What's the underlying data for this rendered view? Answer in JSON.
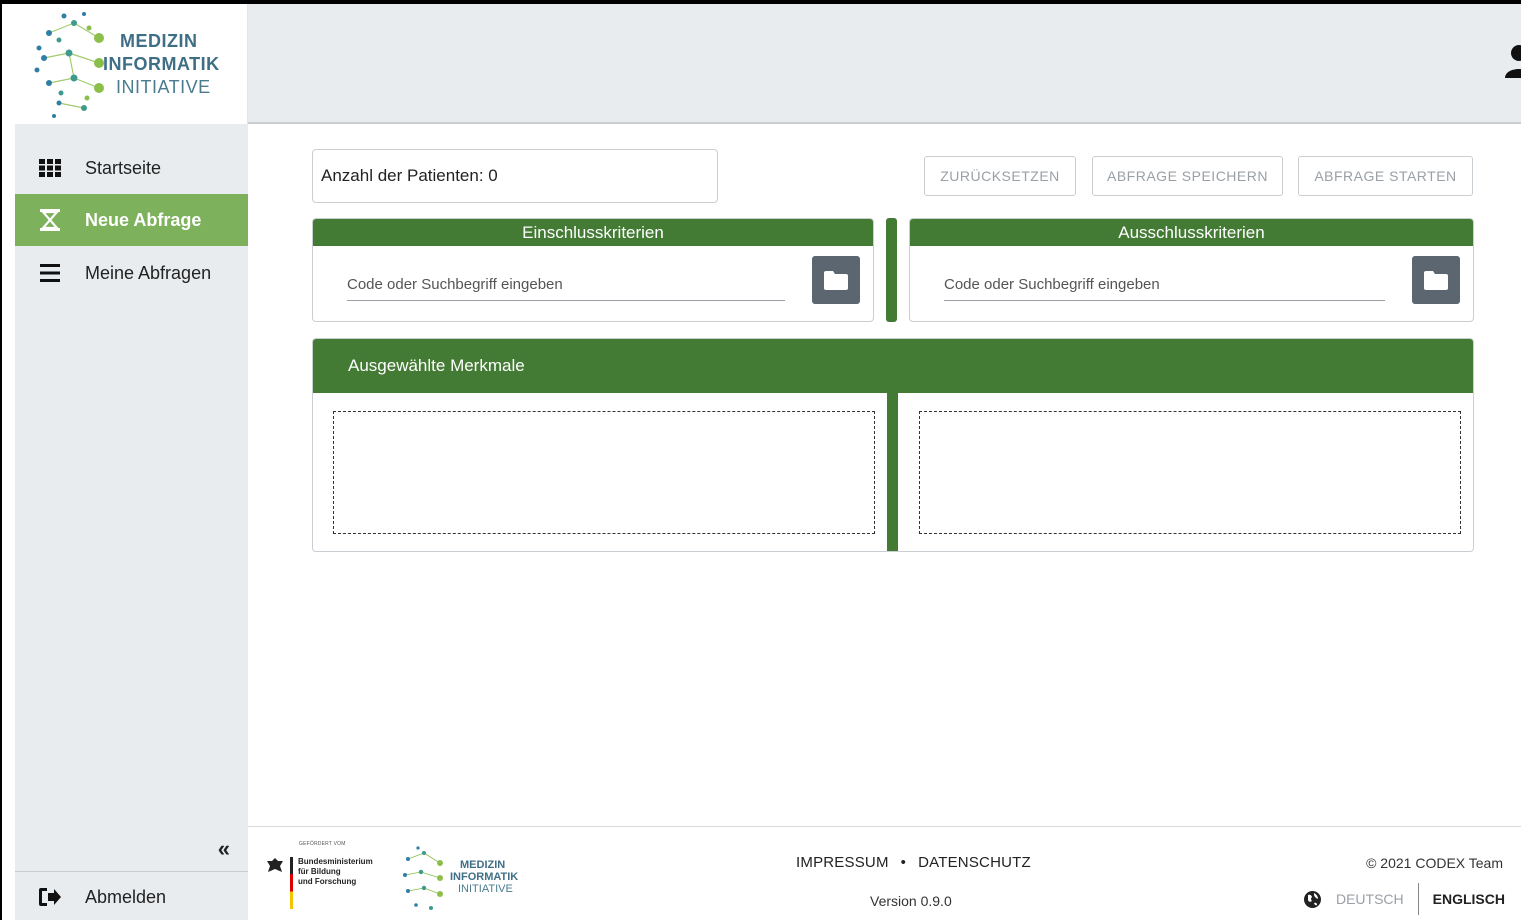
{
  "logo": {
    "line1": "MEDIZIN",
    "line2": "INFORMATIK",
    "line3": "INITIATIVE"
  },
  "sidebar": {
    "items": [
      {
        "label": "Startseite",
        "icon": "grid-icon"
      },
      {
        "label": "Neue Abfrage",
        "icon": "hourglass-icon",
        "active": true
      },
      {
        "label": "Meine Abfragen",
        "icon": "menu-icon"
      }
    ],
    "collapse": "«",
    "logout": "Abmelden"
  },
  "main": {
    "patients": "Anzahl der Patienten: 0",
    "buttons": {
      "reset": "ZURÜCKSETZEN",
      "save": "ABFRAGE SPEICHERN",
      "start": "ABFRAGE STARTEN"
    },
    "inclusion": {
      "title": "Einschlusskriterien",
      "placeholder": "Code oder Suchbegriff eingeben"
    },
    "exclusion": {
      "title": "Ausschlusskriterien",
      "placeholder": "Code oder Suchbegriff eingeben"
    },
    "selected_title": "Ausgewählte Merkmale"
  },
  "footer": {
    "funded_by": "GEFÖRDERT VOM",
    "bmbf_line1": "Bundesministerium",
    "bmbf_line2": "für Bildung",
    "bmbf_line3": "und Forschung",
    "logo_line1": "MEDIZIN",
    "logo_line2": "INFORMATIK",
    "logo_line3": "INITIATIVE",
    "impressum": "IMPRESSUM",
    "separator": "•",
    "datenschutz": "DATENSCHUTZ",
    "version": "Version 0.9.0",
    "copyright": "© 2021 CODEX Team",
    "lang_de": "DEUTSCH",
    "lang_en": "ENGLISCH"
  },
  "colors": {
    "primary_green": "#437a34",
    "active_green": "#7db15b",
    "sidebar_bg": "#e9ecef",
    "folder_btn": "#5b6670"
  }
}
